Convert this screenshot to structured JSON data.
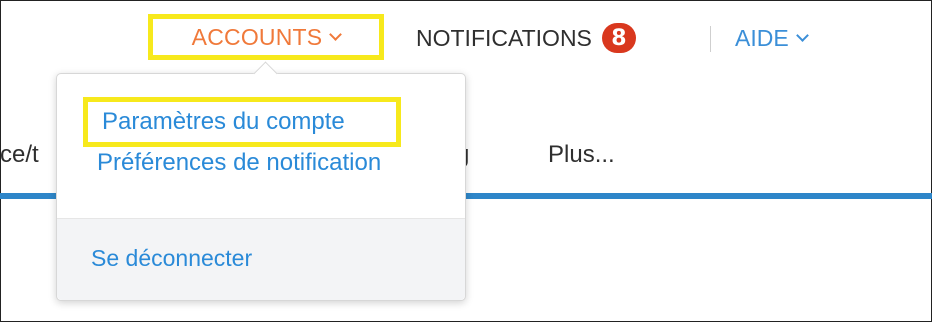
{
  "top_nav": {
    "accounts_label": "ACCOUNTS",
    "notifications_label": "NOTIFICATIONS",
    "notifications_count": "8",
    "aide_label": "AIDE"
  },
  "tabs": {
    "partial_left": "ce/t",
    "partial_mid": "g",
    "plus_label": "Plus..."
  },
  "account_menu": {
    "items": [
      {
        "label": "Paramètres du compte"
      },
      {
        "label": "Préférences de notification"
      }
    ],
    "logout_label": "Se déconnecter"
  },
  "colors": {
    "accent_orange": "#f0793a",
    "link_blue": "#2a8ad8",
    "highlight_yellow": "#f7e91c",
    "badge_red": "#d9381e",
    "bar_blue": "#2e86c9"
  }
}
